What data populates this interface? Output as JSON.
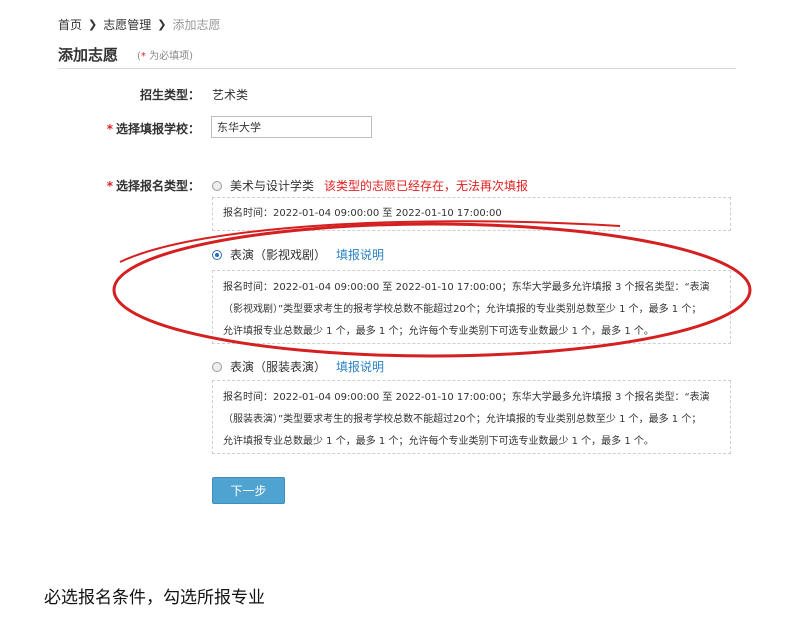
{
  "breadcrumb": {
    "home": "首页",
    "section": "志愿管理",
    "current": "添加志愿"
  },
  "page": {
    "title": "添加志愿",
    "required_note": "为必填项"
  },
  "form": {
    "enroll_type_label": "招生类型：",
    "enroll_type_value": "艺术类",
    "school_label": "选择填报学校：",
    "school_value": "东华大学",
    "category_label": "选择报名类型：",
    "options": [
      {
        "label": "美术与设计学类",
        "warning": "该类型的志愿已经存在，无法再次填报",
        "info": "报名时间：2022-01-04 09:00:00 至 2022-01-10 17:00:00",
        "checked": false
      },
      {
        "label": "表演（影视戏剧）",
        "link": "填报说明",
        "info_lines": [
          "报名时间：2022-01-04 09:00:00 至 2022-01-10 17:00:00；东华大学最多允许填报 3 个报名类型：“表演",
          "（影视戏剧）”类型要求考生的报考学校总数不能超过20个；允许填报的专业类别总数至少 1 个，最多 1 个；",
          "允许填报专业总数最少 1 个，最多 1 个；允许每个专业类别下可选专业数最少 1 个，最多 1 个。"
        ],
        "checked": true
      },
      {
        "label": "表演（服装表演）",
        "link": "填报说明",
        "info_lines": [
          "报名时间：2022-01-04 09:00:00 至 2022-01-10 17:00:00；东华大学最多允许填报 3 个报名类型：“表演",
          "（服装表演）”类型要求考生的报考学校总数不能超过20个；允许填报的专业类别总数至少 1 个，最多 1 个；",
          "允许填报专业总数最少 1 个，最多 1 个；允许每个专业类别下可选专业数最少 1 个，最多 1 个。"
        ],
        "checked": false
      }
    ],
    "next_button": "下一步"
  },
  "caption": "必选报名条件，勾选所报专业",
  "colors": {
    "required_star": "#e02020",
    "warning_text": "#e02020",
    "link": "#2a83c6",
    "button_bg": "#4fa3d0",
    "annotation_ellipse": "#d42020"
  }
}
